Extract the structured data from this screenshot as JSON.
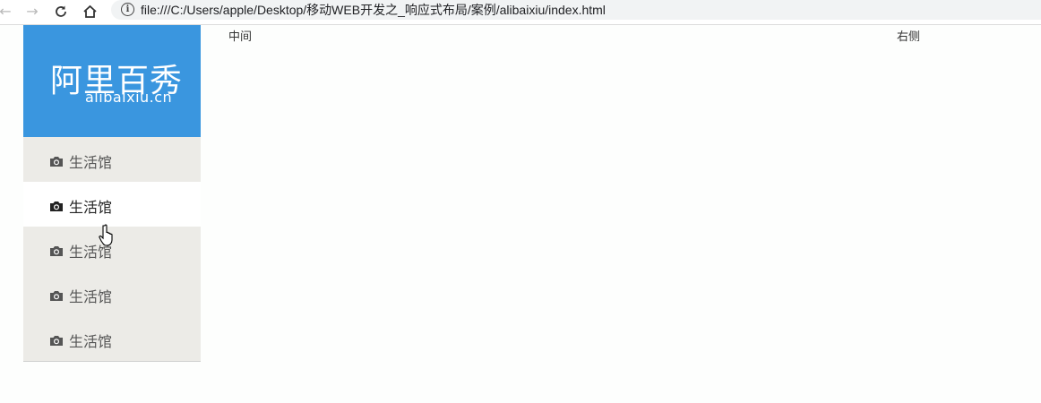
{
  "browser": {
    "url": "file:///C:/Users/apple/Desktop/移动WEB开发之_响应式布局/案例/alibaixiu/index.html",
    "info_icon": "info-icon"
  },
  "logo": {
    "title_cn": "阿里百秀",
    "domain": "alibaixiu.cn"
  },
  "menu": {
    "items": [
      {
        "label": "生活馆",
        "icon": "camera-icon",
        "active": false
      },
      {
        "label": "生活馆",
        "icon": "camera-icon",
        "active": true
      },
      {
        "label": "生活馆",
        "icon": "camera-icon",
        "active": false
      },
      {
        "label": "生活馆",
        "icon": "camera-icon",
        "active": false
      },
      {
        "label": "生活馆",
        "icon": "camera-icon",
        "active": false
      }
    ]
  },
  "columns": {
    "middle": "中间",
    "right": "右侧"
  },
  "colors": {
    "brand_blue": "#3a96df",
    "menu_bg": "#ecebe7",
    "menu_active_bg": "#ffffff"
  }
}
